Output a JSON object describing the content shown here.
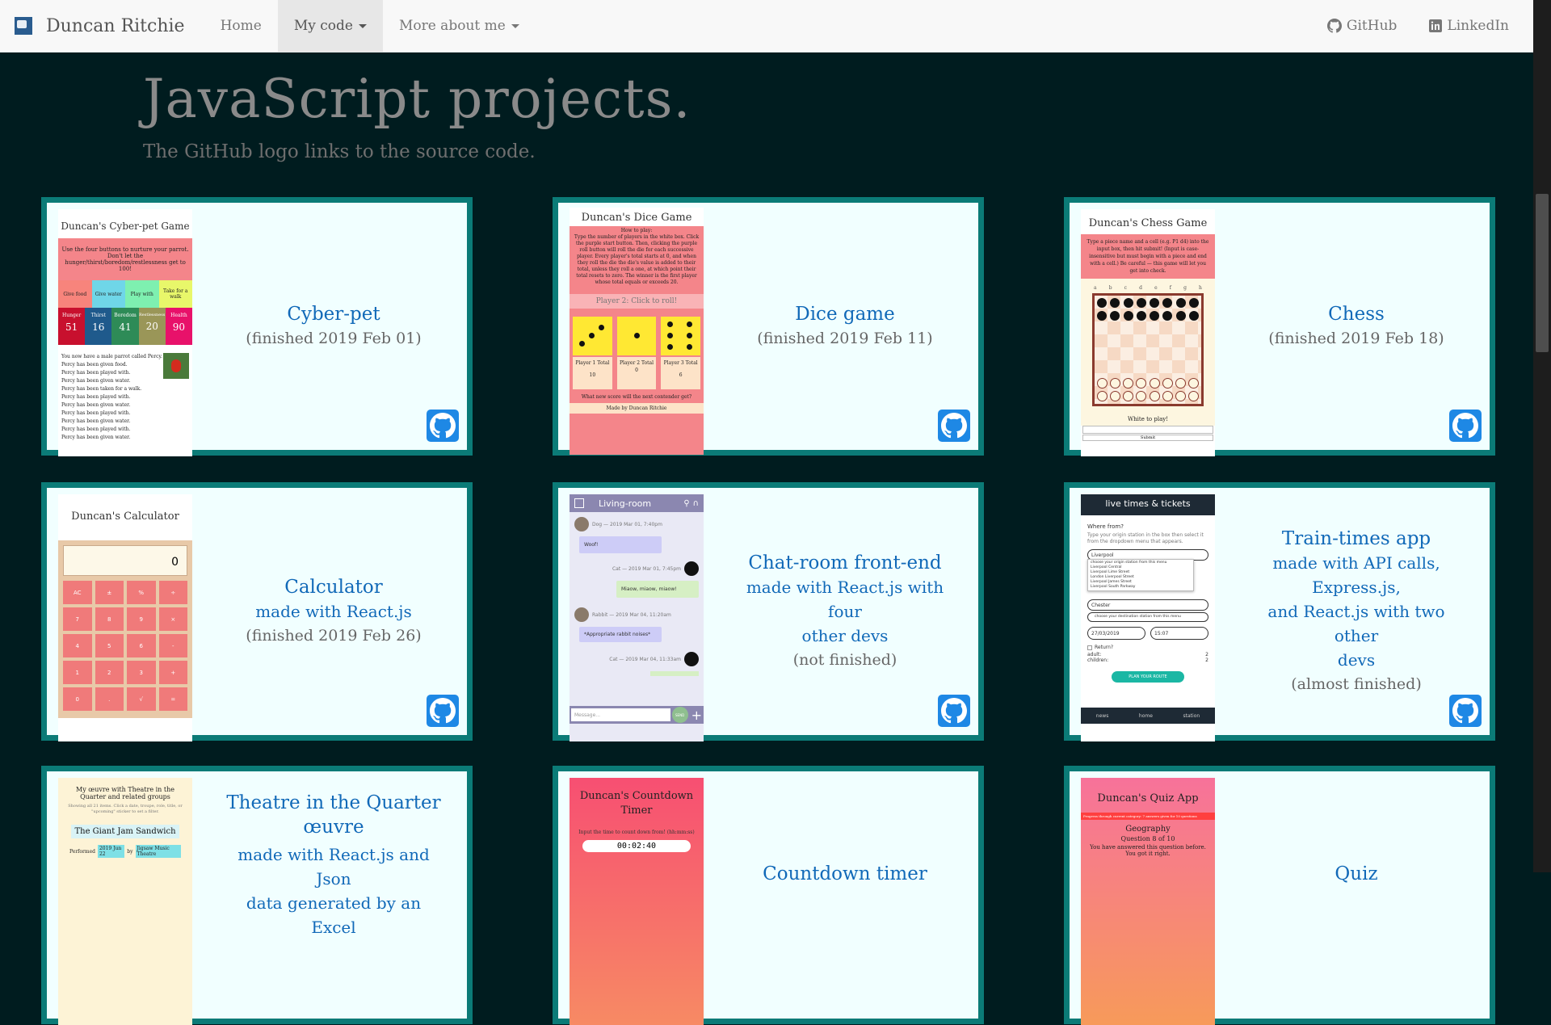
{
  "navbar": {
    "brand": "Duncan Ritchie",
    "items": [
      "Home",
      "My code",
      "More about me"
    ],
    "right": [
      "GitHub",
      "LinkedIn"
    ]
  },
  "page": {
    "title": "JavaScript projects.",
    "subtitle": "The GitHub logo links to the source code."
  },
  "projects": [
    {
      "title": "Cyber-pet",
      "lines": [],
      "status": "(finished 2019 Feb 01)",
      "thumb": {
        "title": "Duncan's Cyber-pet Game",
        "intro": "Use the four buttons to nurture your parrot. Don't let the hunger/thirst/boredom/restlessness get to 100!",
        "buttons": [
          "Give food",
          "Give water",
          "Play with",
          "Take for a walk"
        ],
        "stats": [
          {
            "label": "Hunger",
            "value": "51"
          },
          {
            "label": "Thirst",
            "value": "16"
          },
          {
            "label": "Boredom",
            "value": "41"
          },
          {
            "label": "Restlessness",
            "value": "20"
          },
          {
            "label": "Health",
            "value": "90"
          }
        ],
        "log": [
          "You now have a male parrot called Percy.",
          "Percy has been given food.",
          "Percy has been played with.",
          "Percy has been given water.",
          "Percy has been taken for a walk.",
          "Percy has been played with.",
          "Percy has been given water.",
          "Percy has been played with.",
          "Percy has been given water.",
          "Percy has been played with.",
          "Percy has been given water."
        ]
      }
    },
    {
      "title": "Dice game",
      "lines": [],
      "status": "(finished 2019 Feb 11)",
      "thumb": {
        "title": "Duncan's Dice Game",
        "howto": "How to play:",
        "instructions": "Type the number of players in the white box. Click the purple start button. Then, clicking the purple roll button will roll the die for each successive player. Every player's total starts at 0, and when they roll the die the die's value is added to their total, unless they roll a one, at which point their total resets to zero. The winner is the first player whose total equals or exceeds 20.",
        "roll": "Player 2: Click to roll!",
        "players": [
          {
            "label": "Player 1 Total",
            "value": "10"
          },
          {
            "label": "Player 2 Total",
            "value": "0"
          },
          {
            "label": "Player 3 Total",
            "value": "6"
          }
        ],
        "question": "What new score will the next contender get?",
        "credit": "Made by Duncan Ritchie"
      }
    },
    {
      "title": "Chess",
      "lines": [],
      "status": "(finished 2019 Feb 18)",
      "thumb": {
        "title": "Duncan's Chess Game",
        "intro": "Type a piece name and a cell (e.g. P1 d4) into the input box, then hit submit! (Input is case-insensitive but must begin with a piece and end with a cell.) Be careful — this game will let you get into check.",
        "files": [
          "a",
          "b",
          "c",
          "d",
          "e",
          "f",
          "g",
          "h"
        ],
        "turn": "White to play!",
        "submit": "Submit"
      }
    },
    {
      "title": "Calculator",
      "lines": [
        "made with React.js"
      ],
      "status": "(finished 2019 Feb 26)",
      "thumb": {
        "title": "Duncan's Calculator",
        "display": "0",
        "keys": [
          "AC",
          "±",
          "%",
          "÷",
          "7",
          "8",
          "9",
          "×",
          "4",
          "5",
          "6",
          "-",
          "1",
          "2",
          "3",
          "+",
          "0",
          ".",
          "√",
          "="
        ]
      }
    },
    {
      "title": "Chat-room front-end",
      "lines": [
        "made with React.js with four",
        "other devs"
      ],
      "status": "(not finished)",
      "thumb": {
        "room": "Living-room",
        "messages": [
          {
            "name": "Dog",
            "time": "— 2019 Mar 01, 7:40pm",
            "text": "Woof!",
            "side": "left"
          },
          {
            "name": "Cat",
            "time": "— 2019 Mar 01, 7:45pm",
            "text": "Miaow, miaow, miaow!",
            "side": "right"
          },
          {
            "name": "Rabbit",
            "time": "— 2019 Mar 04, 11:20am",
            "text": "*Appropriate rabbit noises*",
            "side": "left"
          },
          {
            "name": "Cat",
            "time": "— 2019 Mar 04, 11:33am",
            "text": "",
            "side": "right"
          }
        ],
        "placeholder": "Message...",
        "send": "SEND"
      }
    },
    {
      "title": "Train-times app",
      "lines": [
        "made with API calls, Express.js,",
        "and React.js with two other",
        "devs"
      ],
      "status": "(almost finished)",
      "thumb": {
        "header": "live times & tickets",
        "where": "Where from?",
        "hint": "Type your origin station in the box then select it from the dropdown menu that appears.",
        "from": "Liverpool",
        "to": "Chester",
        "date": "27/03/2019",
        "time": "15:07",
        "options": [
          "choose your origin station from this menu",
          "Liverpool Central",
          "Liverpool Lime Street",
          "London Liverpool Street",
          "Liverpool James Street",
          "Liverpool South Parkway"
        ],
        "dest_hint": "choose your destination station from this menu",
        "ret": "Return?",
        "adult": "adult:",
        "adult_n": "2",
        "children": "children:",
        "children_n": "2",
        "plan": "PLAN YOUR ROUTE",
        "tabs": [
          "news",
          "home",
          "station"
        ]
      }
    },
    {
      "title": "Theatre in the Quarter œuvre",
      "lines": [
        "made with React.js and Json",
        "data generated by an Excel"
      ],
      "status": "",
      "thumb": {
        "title": "My œuvre with Theatre in the Quarter and related groups",
        "hint": "Showing all 21 items. Click a date, troupe, role, title, or \"upcoming\" sticker to set a filter.",
        "show": "The Giant Jam Sandwich",
        "performed": "Performed",
        "date": "2019 Jun 22",
        "by": "by",
        "troupe": "Jigsaw Music Theatre"
      }
    },
    {
      "title": "Countdown timer",
      "lines": [],
      "status": "",
      "thumb": {
        "title": "Duncan's Countdown Timer",
        "hint": "Input the time to count down from! (hh:mm:ss)",
        "time": "00:02:40"
      }
    },
    {
      "title": "Quiz",
      "lines": [],
      "status": "",
      "thumb": {
        "title": "Duncan's Quiz App",
        "progress": "Progress through current category: 7 answers given for 10 questions",
        "category": "Geography",
        "question": "Question 8 of 10",
        "answered": "You have answered this question before.",
        "gotit": "You got it right."
      }
    }
  ],
  "colors": {
    "background": "#001c1f",
    "card_border": "#0b7b77",
    "card_bg": "#f1ffff",
    "link": "#1169b8",
    "github_button": "#1e88e5"
  }
}
